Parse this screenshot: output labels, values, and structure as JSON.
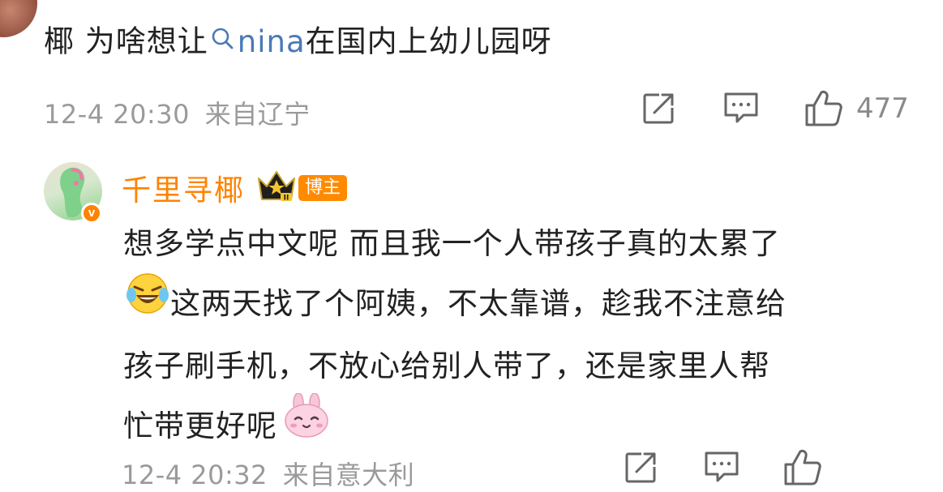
{
  "top_comment": {
    "text_before": "椰 为啥想让",
    "mention": "nina",
    "text_after": "在国内上幼儿园呀",
    "timestamp": "12-4 20:30",
    "location": "来自辽宁",
    "like_count": "477"
  },
  "reply": {
    "username": "千里寻椰",
    "badge": "博主",
    "line1": "想多学点中文呢 而且我一个人带孩子真的太累了",
    "line2": "这两天找了个阿姨，不太靠谱，趁我不注意给",
    "line3": "孩子刷手机，不放心给别人带了，还是家里人帮",
    "line4": "忙带更好呢",
    "emoji_line2": "laughing-crying-emoji",
    "emoji_line4": "bunny-emoji",
    "timestamp": "12-4 20:32",
    "location": "来自意大利"
  },
  "colors": {
    "accent_orange": "#ff8200",
    "mention_blue": "#4a79b8",
    "meta_gray": "#9a9a9a"
  },
  "icons": [
    "share-icon",
    "comment-icon",
    "like-icon",
    "verified-badge-icon",
    "crown-level-icon"
  ]
}
